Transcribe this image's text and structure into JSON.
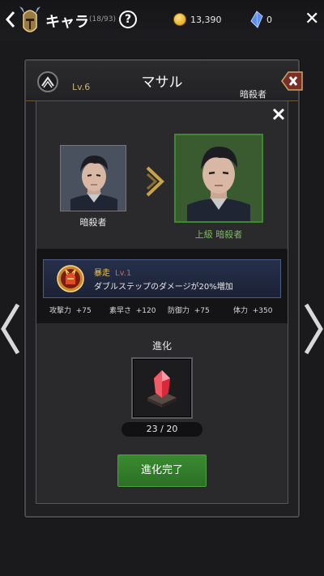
{
  "topbar": {
    "back_icon": "chevron-left-icon",
    "title": "キャラ",
    "count": "(18/93)",
    "help_label": "?",
    "gold": "13,390",
    "crystal": "0",
    "close_label": "✕"
  },
  "character": {
    "name": "マサル",
    "level": "Lv.6",
    "class": "暗殺者"
  },
  "evolution": {
    "from_class": "暗殺者",
    "to_class": "上級 暗殺者",
    "skill": {
      "name": "暴走",
      "level": "Lv.1",
      "description": "ダブルステップのダメージが20%増加"
    },
    "stats": [
      {
        "label": "攻撃力",
        "value": "+75"
      },
      {
        "label": "素早さ",
        "value": "+120"
      },
      {
        "label": "防御力",
        "value": "+75"
      },
      {
        "label": "体力",
        "value": "+350"
      }
    ],
    "section_label": "進化",
    "material_count": "23 / 20",
    "button_label": "進化完了"
  },
  "colors": {
    "accent_green": "#3a8a30",
    "gold_text": "#c9b27a",
    "skill_name": "#f2c14e",
    "skill_level": "#e55b4a",
    "upgraded_class": "#6fc44a"
  }
}
